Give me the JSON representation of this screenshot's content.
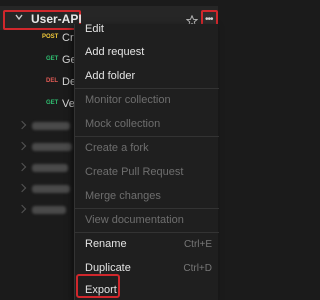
{
  "collection": {
    "name": "User-API"
  },
  "requests": [
    {
      "method": "POST",
      "method_color": "#f0c83a",
      "name": "Cr"
    },
    {
      "method": "GET",
      "method_color": "#2fbf71",
      "name": "Ge"
    },
    {
      "method": "DEL",
      "method_color": "#e25b55",
      "name": "De"
    },
    {
      "method": "GET",
      "method_color": "#2fbf71",
      "name": "Ve"
    }
  ],
  "context_menu": {
    "items": [
      {
        "label": "Edit",
        "enabled": true
      },
      {
        "label": "Add request",
        "enabled": true
      },
      {
        "label": "Add folder",
        "enabled": true
      },
      {
        "label": "Monitor collection",
        "enabled": false
      },
      {
        "label": "Mock collection",
        "enabled": false
      },
      {
        "label": "Create a fork",
        "enabled": false
      },
      {
        "label": "Create Pull Request",
        "enabled": false
      },
      {
        "label": "Merge changes",
        "enabled": false
      },
      {
        "label": "View documentation",
        "enabled": false
      },
      {
        "label": "Rename",
        "enabled": true,
        "shortcut": "Ctrl+E"
      },
      {
        "label": "Duplicate",
        "enabled": true,
        "shortcut": "Ctrl+D"
      },
      {
        "label": "Export",
        "enabled": true
      }
    ]
  },
  "colors": {
    "highlight": "#d0272c",
    "background": "#1b1b1b",
    "menu_background": "#1f1f1f"
  },
  "icons": {
    "chevron": "chevron-down-icon",
    "star": "star-icon",
    "more": "more-options-icon"
  }
}
